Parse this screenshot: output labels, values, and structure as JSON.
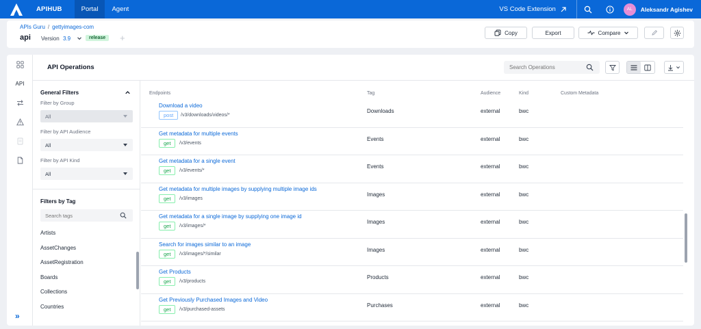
{
  "nav": {
    "brand": "APIHUB",
    "tabs": [
      {
        "label": "Portal",
        "active": true
      },
      {
        "label": "Agent",
        "active": false
      }
    ],
    "vscode_label": "VS Code Extension",
    "avatar_initials": "AL",
    "user_name": "Aleksandr Agishev"
  },
  "header": {
    "breadcrumb": [
      "APIs Guru",
      "gettyimages-com"
    ],
    "title": "api",
    "version_label": "Version",
    "version_value": "3.9",
    "status": "release",
    "copy_label": "Copy",
    "export_label": "Export",
    "compare_label": "Compare"
  },
  "rail": {
    "active_label": "API"
  },
  "main": {
    "title": "API Operations",
    "search_placeholder": "Search Operations"
  },
  "filters": {
    "general_title": "General Filters",
    "group_label": "Filter by Group",
    "group_value": "All",
    "audience_label": "Filter by API Audience",
    "audience_value": "All",
    "kind_label": "Filter by API Kind",
    "kind_value": "All",
    "tags_title": "Filters by Tag",
    "tag_search_placeholder": "Search tags",
    "tags": [
      "Artists",
      "AssetChanges",
      "AssetRegistration",
      "Boards",
      "Collections",
      "Countries"
    ]
  },
  "table": {
    "columns": [
      "Endpoints",
      "Tag",
      "Audience",
      "Kind",
      "Custom Metadata"
    ],
    "rows": [
      {
        "title": "Download a video",
        "method": "post",
        "path": "/v3/downloads/videos/*",
        "tag": "Downloads",
        "audience": "external",
        "kind": "bwc"
      },
      {
        "title": "Get metadata for multiple events",
        "method": "get",
        "path": "/v3/events",
        "tag": "Events",
        "audience": "external",
        "kind": "bwc"
      },
      {
        "title": "Get metadata for a single event",
        "method": "get",
        "path": "/v3/events/*",
        "tag": "Events",
        "audience": "external",
        "kind": "bwc"
      },
      {
        "title": "Get metadata for multiple images by supplying multiple image ids",
        "method": "get",
        "path": "/v3/images",
        "tag": "Images",
        "audience": "external",
        "kind": "bwc"
      },
      {
        "title": "Get metadata for a single image by supplying one image id",
        "method": "get",
        "path": "/v3/images/*",
        "tag": "Images",
        "audience": "external",
        "kind": "bwc"
      },
      {
        "title": "Search for images similar to an image",
        "method": "get",
        "path": "/v3/images/*/similar",
        "tag": "Images",
        "audience": "external",
        "kind": "bwc"
      },
      {
        "title": "Get Products",
        "method": "get",
        "path": "/v3/products",
        "tag": "Products",
        "audience": "external",
        "kind": "bwc"
      },
      {
        "title": "Get Previously Purchased Images and Video",
        "method": "get",
        "path": "/v3/purchased-assets",
        "tag": "Purchases",
        "audience": "external",
        "kind": "bwc"
      }
    ]
  },
  "colors": {
    "brand": "#0a68d8",
    "get_method": "#16a34a",
    "release_badge": "#d1f5dd"
  }
}
